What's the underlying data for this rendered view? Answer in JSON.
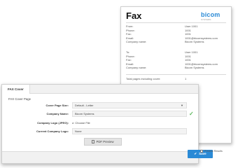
{
  "fax_preview": {
    "title": "Fax",
    "logo": "bicom",
    "logo_sub": "SYSTEMS",
    "from_rows": [
      {
        "label": "From:",
        "value": "User 1001"
      },
      {
        "label": "Phone:",
        "value": "1001"
      },
      {
        "label": "Fax:",
        "value": "1001"
      },
      {
        "label": "Email:",
        "value": "1001@bicomsystems.com"
      },
      {
        "label": "Company name:",
        "value": "Bicom Systems"
      }
    ],
    "to_rows": [
      {
        "label": "To:",
        "value": "User 1001"
      },
      {
        "label": "Phone:",
        "value": "1001"
      },
      {
        "label": "Fax:",
        "value": "1001"
      },
      {
        "label": "Email:",
        "value": "1001@bicomsystems.com"
      },
      {
        "label": "Company name:",
        "value": "Bicom Systems"
      }
    ],
    "total_pages_label": "Total pages including cover:",
    "total_pages_value": "1"
  },
  "panel": {
    "tab": "FAX Cover",
    "section": "FAX Cover Page",
    "fields": {
      "page_size": {
        "label": "Cover Page Size:",
        "value": "Default - Letter"
      },
      "company_name": {
        "label": "Company Name:",
        "value": "Bicom Systems"
      },
      "company_logo": {
        "label": "Company Logo (JPEG):",
        "button": "Choose File"
      },
      "current_logo": {
        "label": "Current Company Logo:",
        "value": "None"
      }
    },
    "pdf_button": "PDF Preview",
    "save_button": "Save",
    "preview_checkbox": "Preview Results"
  },
  "colors": {
    "accent": "#2a8ad6",
    "success": "#5cb85c"
  },
  "icons": [
    "caret-down-icon",
    "checkmark-icon",
    "paperclip-icon",
    "document-icon",
    "save-check-icon",
    "checkbox-icon"
  ]
}
